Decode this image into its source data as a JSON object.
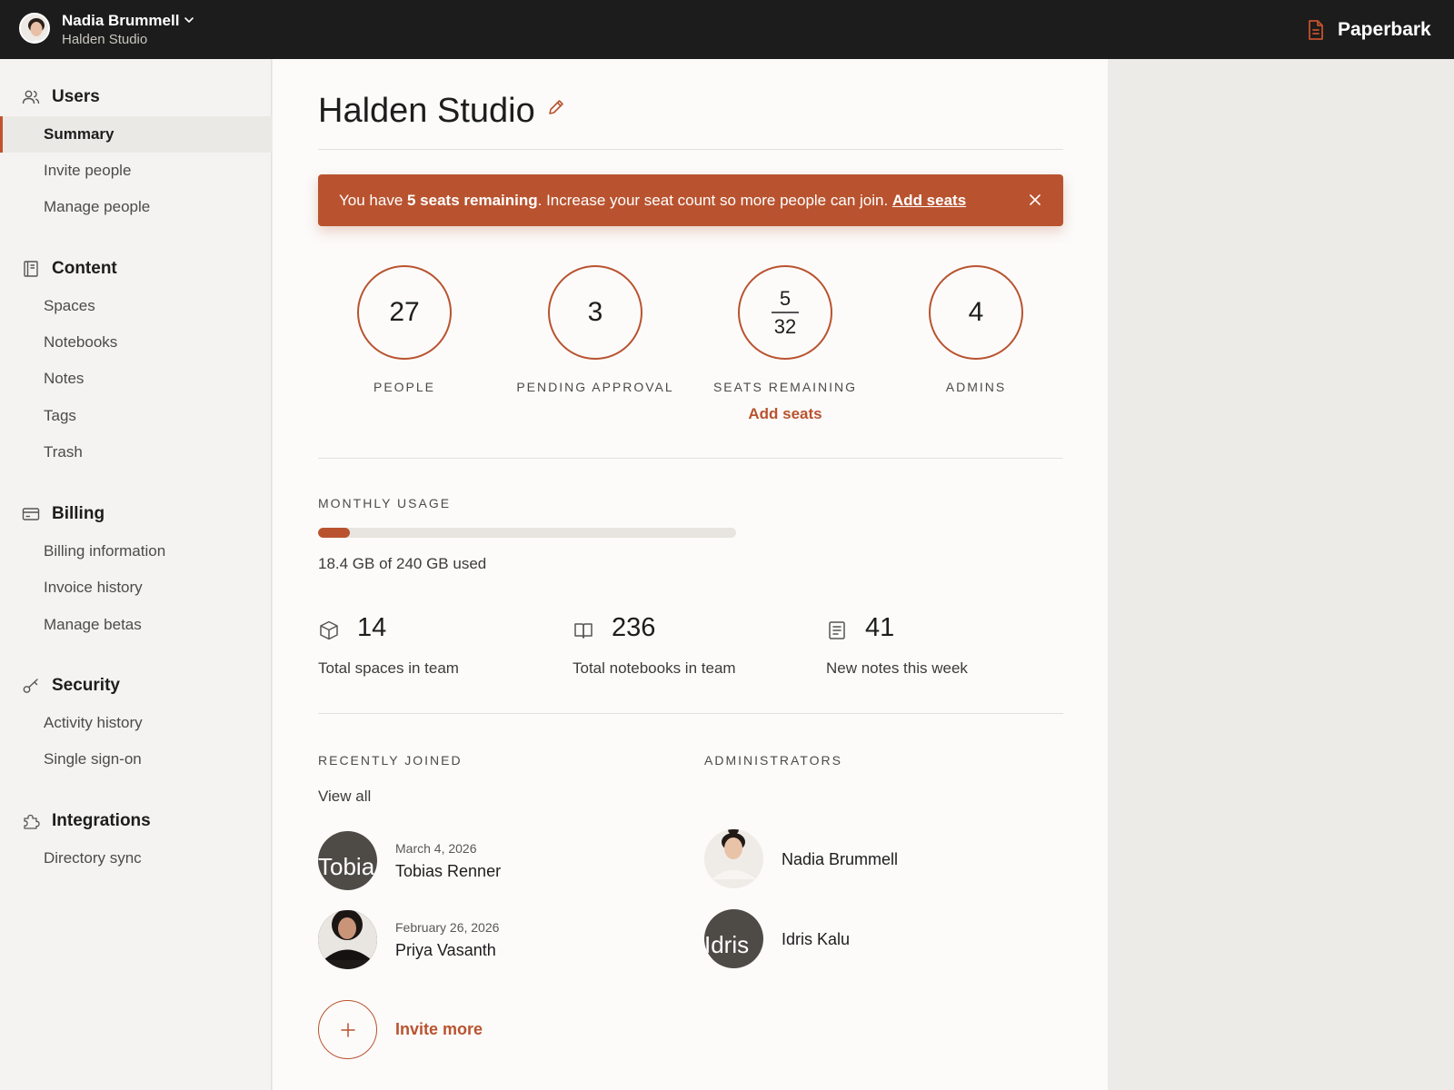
{
  "topbar": {
    "user_name": "Nadia Brummell",
    "org_name": "Halden Studio",
    "brand": "Paperbark"
  },
  "sidebar": {
    "sections": [
      {
        "title": "Users",
        "icon": "users-icon",
        "items": [
          "Summary",
          "Invite people",
          "Manage people"
        ]
      },
      {
        "title": "Content",
        "icon": "notebook-icon",
        "items": [
          "Spaces",
          "Notebooks",
          "Notes",
          "Tags",
          "Trash"
        ]
      },
      {
        "title": "Billing",
        "icon": "credit-card-icon",
        "items": [
          "Billing information",
          "Invoice history",
          "Manage betas"
        ]
      },
      {
        "title": "Security",
        "icon": "key-icon",
        "items": [
          "Activity history",
          "Single sign-on"
        ]
      },
      {
        "title": "Integrations",
        "icon": "puzzle-icon",
        "items": [
          "Directory sync"
        ]
      }
    ],
    "active_item": "Summary"
  },
  "main": {
    "title": "Halden Studio",
    "banner": {
      "prefix": "You have ",
      "highlight": "5 seats remaining",
      "suffix": ". Increase your seat count so more people can join. ",
      "link": "Add seats"
    },
    "stats": {
      "people": {
        "value": "27",
        "label": "PEOPLE"
      },
      "pending": {
        "value": "3",
        "label": "PENDING APPROVAL"
      },
      "seats": {
        "remaining": "5",
        "total": "32",
        "label": "SEATS REMAINING",
        "link": "Add seats"
      },
      "admins": {
        "value": "4",
        "label": "ADMINS"
      }
    },
    "usage": {
      "label": "MONTHLY USAGE",
      "text": "18.4 GB of 240 GB used",
      "fraction": 0.077
    },
    "metrics": {
      "spaces": {
        "value": "14",
        "label": "Total spaces in team"
      },
      "notebooks": {
        "value": "236",
        "label": "Total notebooks in team"
      },
      "notes": {
        "value": "41",
        "label": "New notes this week"
      }
    },
    "recently_joined": {
      "label": "RECENTLY JOINED",
      "view_all": "View all",
      "people": [
        {
          "date": "March 4, 2026",
          "name": "Tobias Renner",
          "avatar_alt": "Tobia"
        },
        {
          "date": "February 26, 2026",
          "name": "Priya Vasanth"
        }
      ]
    },
    "administrators": {
      "label": "ADMINISTRATORS",
      "people": [
        {
          "name": "Nadia Brummell"
        },
        {
          "name": "Idris Kalu",
          "avatar_alt": "Idris"
        }
      ]
    },
    "invite_more": "Invite more"
  },
  "colors": {
    "accent": "#b9532f",
    "topbar": "#1c1c1c",
    "sidebar": "#f4f3f1"
  }
}
